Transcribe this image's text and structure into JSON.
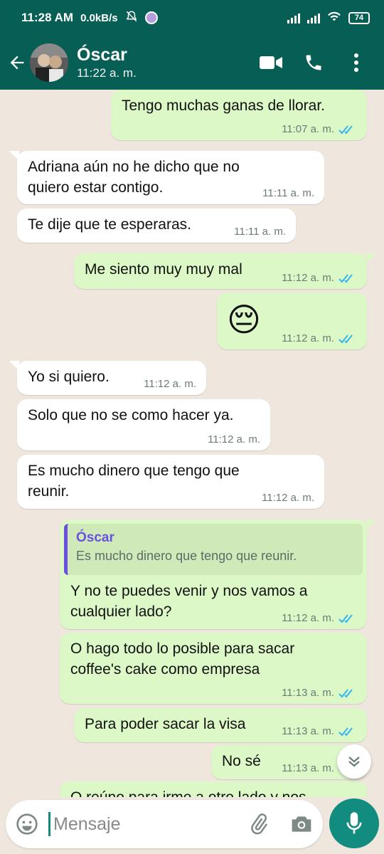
{
  "status_bar": {
    "time": "11:28 AM",
    "net_speed": "0.0kB/s",
    "battery": "74"
  },
  "header": {
    "contact_name": "Óscar",
    "contact_status": "11:22 a. m."
  },
  "messages": [
    {
      "dir": "out",
      "text": "Tengo muchas ganas de llorar.",
      "time": "11:07 a. m.",
      "ticks": "read"
    },
    {
      "dir": "in",
      "text": "Adriana aún no he dicho que no\nquiero estar contigo.",
      "time": "11:11 a. m."
    },
    {
      "dir": "in",
      "text": "Te dije que te esperaras.",
      "time": "11:11 a. m."
    },
    {
      "dir": "out",
      "text": "Me siento muy muy mal",
      "time": "11:12 a. m.",
      "ticks": "read"
    },
    {
      "dir": "out",
      "emoji": "😔",
      "time": "11:12 a. m.",
      "ticks": "read"
    },
    {
      "dir": "in",
      "text": "Yo si quiero.",
      "time": "11:12 a. m."
    },
    {
      "dir": "in",
      "text": "Solo que no se como hacer ya.",
      "time": "11:12 a. m."
    },
    {
      "dir": "in",
      "text": "Es mucho dinero que tengo que\nreunir.",
      "time": "11:12 a. m."
    },
    {
      "dir": "out",
      "quote_author": "Óscar",
      "quote_text": "Es mucho dinero que tengo que reunir.",
      "text": "Y no te puedes venir y nos vamos a\ncualquier lado?",
      "time": "11:12 a. m.",
      "ticks": "read"
    },
    {
      "dir": "out",
      "text": "O hago todo lo posible para sacar\ncoffee's cake como empresa",
      "time": "11:13 a. m.",
      "ticks": "read"
    },
    {
      "dir": "out",
      "text": "Para poder sacar la visa",
      "time": "11:13 a. m.",
      "ticks": "read"
    },
    {
      "dir": "out",
      "text": "No sé",
      "time": "11:13 a. m.",
      "ticks": "read"
    },
    {
      "dir": "out",
      "text": "O reúno para irme a otro lado y nos",
      "time": "",
      "ticks": ""
    }
  ],
  "composer": {
    "placeholder": "Mensaje"
  },
  "colors": {
    "header": "#075e54",
    "outgoing_bubble": "#dcf8c6",
    "incoming_bubble": "#ffffff",
    "read_ticks": "#34b7f1",
    "mic_button": "#128c7e"
  },
  "icons": {
    "back": "arrow-left-icon",
    "video": "video-camera-icon",
    "call": "phone-icon",
    "menu": "more-vert-icon",
    "emoji": "emoji-icon",
    "attach": "paperclip-icon",
    "camera": "camera-icon",
    "mic": "microphone-icon",
    "scroll_down": "chevrons-down-icon"
  }
}
